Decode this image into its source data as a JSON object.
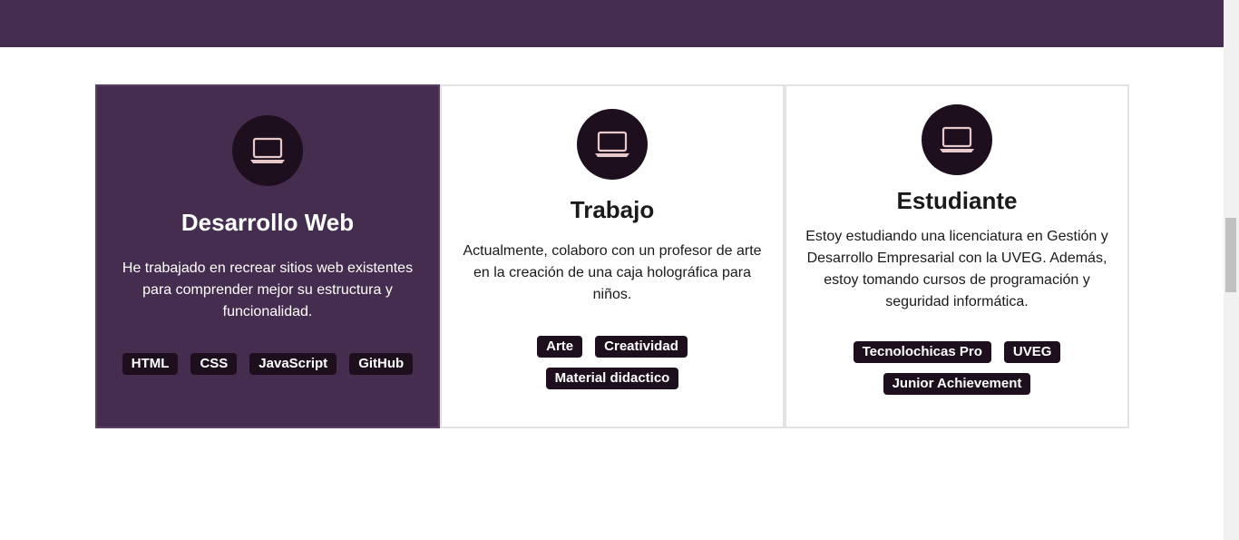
{
  "cards": [
    {
      "icon": "laptop-icon",
      "title": "Desarrollo Web",
      "text": "He trabajado en recrear sitios web existentes para comprender mejor su estructura y funcionalidad.",
      "tags": [
        "HTML",
        "CSS",
        "JavaScript",
        "GitHub"
      ]
    },
    {
      "icon": "laptop-icon",
      "title": "Trabajo",
      "text": "Actualmente, colaboro con un profesor de arte en la creación de una caja holográfica para niños.",
      "tags": [
        "Arte",
        "Creatividad",
        "Material didactico"
      ]
    },
    {
      "icon": "laptop-icon",
      "title": "Estudiante",
      "text": "Estoy estudiando una licenciatura en Gestión y Desarrollo Empresarial con la UVEG. Además, estoy tomando cursos de programación y seguridad informática.",
      "tags": [
        "Tecnolochicas Pro",
        "UVEG",
        "Junior Achievement"
      ]
    }
  ],
  "colors": {
    "accent": "#452d4f",
    "tag_bg": "#1e0f1f",
    "icon_stroke": "#e8c9cc"
  }
}
